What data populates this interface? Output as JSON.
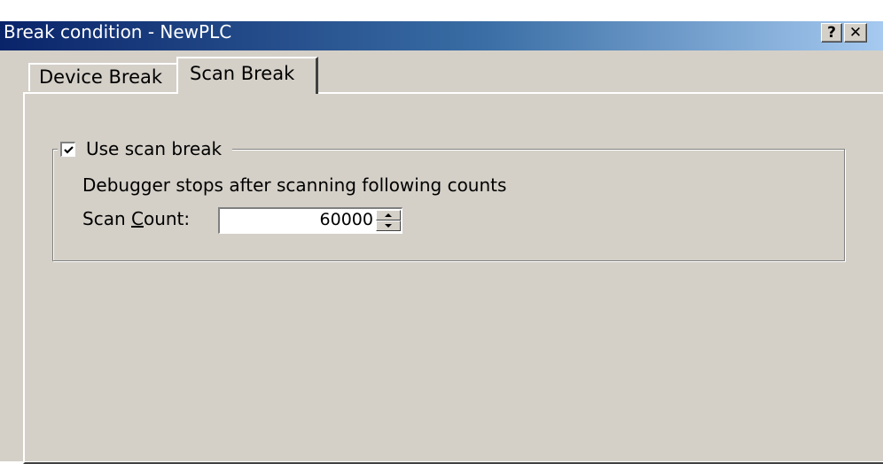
{
  "window": {
    "title": "Break condition - NewPLC",
    "help_button": "?",
    "close_button": "✕"
  },
  "tabs": [
    {
      "label": "Device Break",
      "active": false
    },
    {
      "label": "Scan Break",
      "active": true
    }
  ],
  "scan_break": {
    "use_scan_break_label": "Use scan break",
    "use_scan_break_checked": true,
    "description": "Debugger stops after scanning following counts",
    "scan_count_label_prefix": "Scan ",
    "scan_count_label_mnemonic": "C",
    "scan_count_label_suffix": "ount:",
    "scan_count_value": "60000"
  }
}
